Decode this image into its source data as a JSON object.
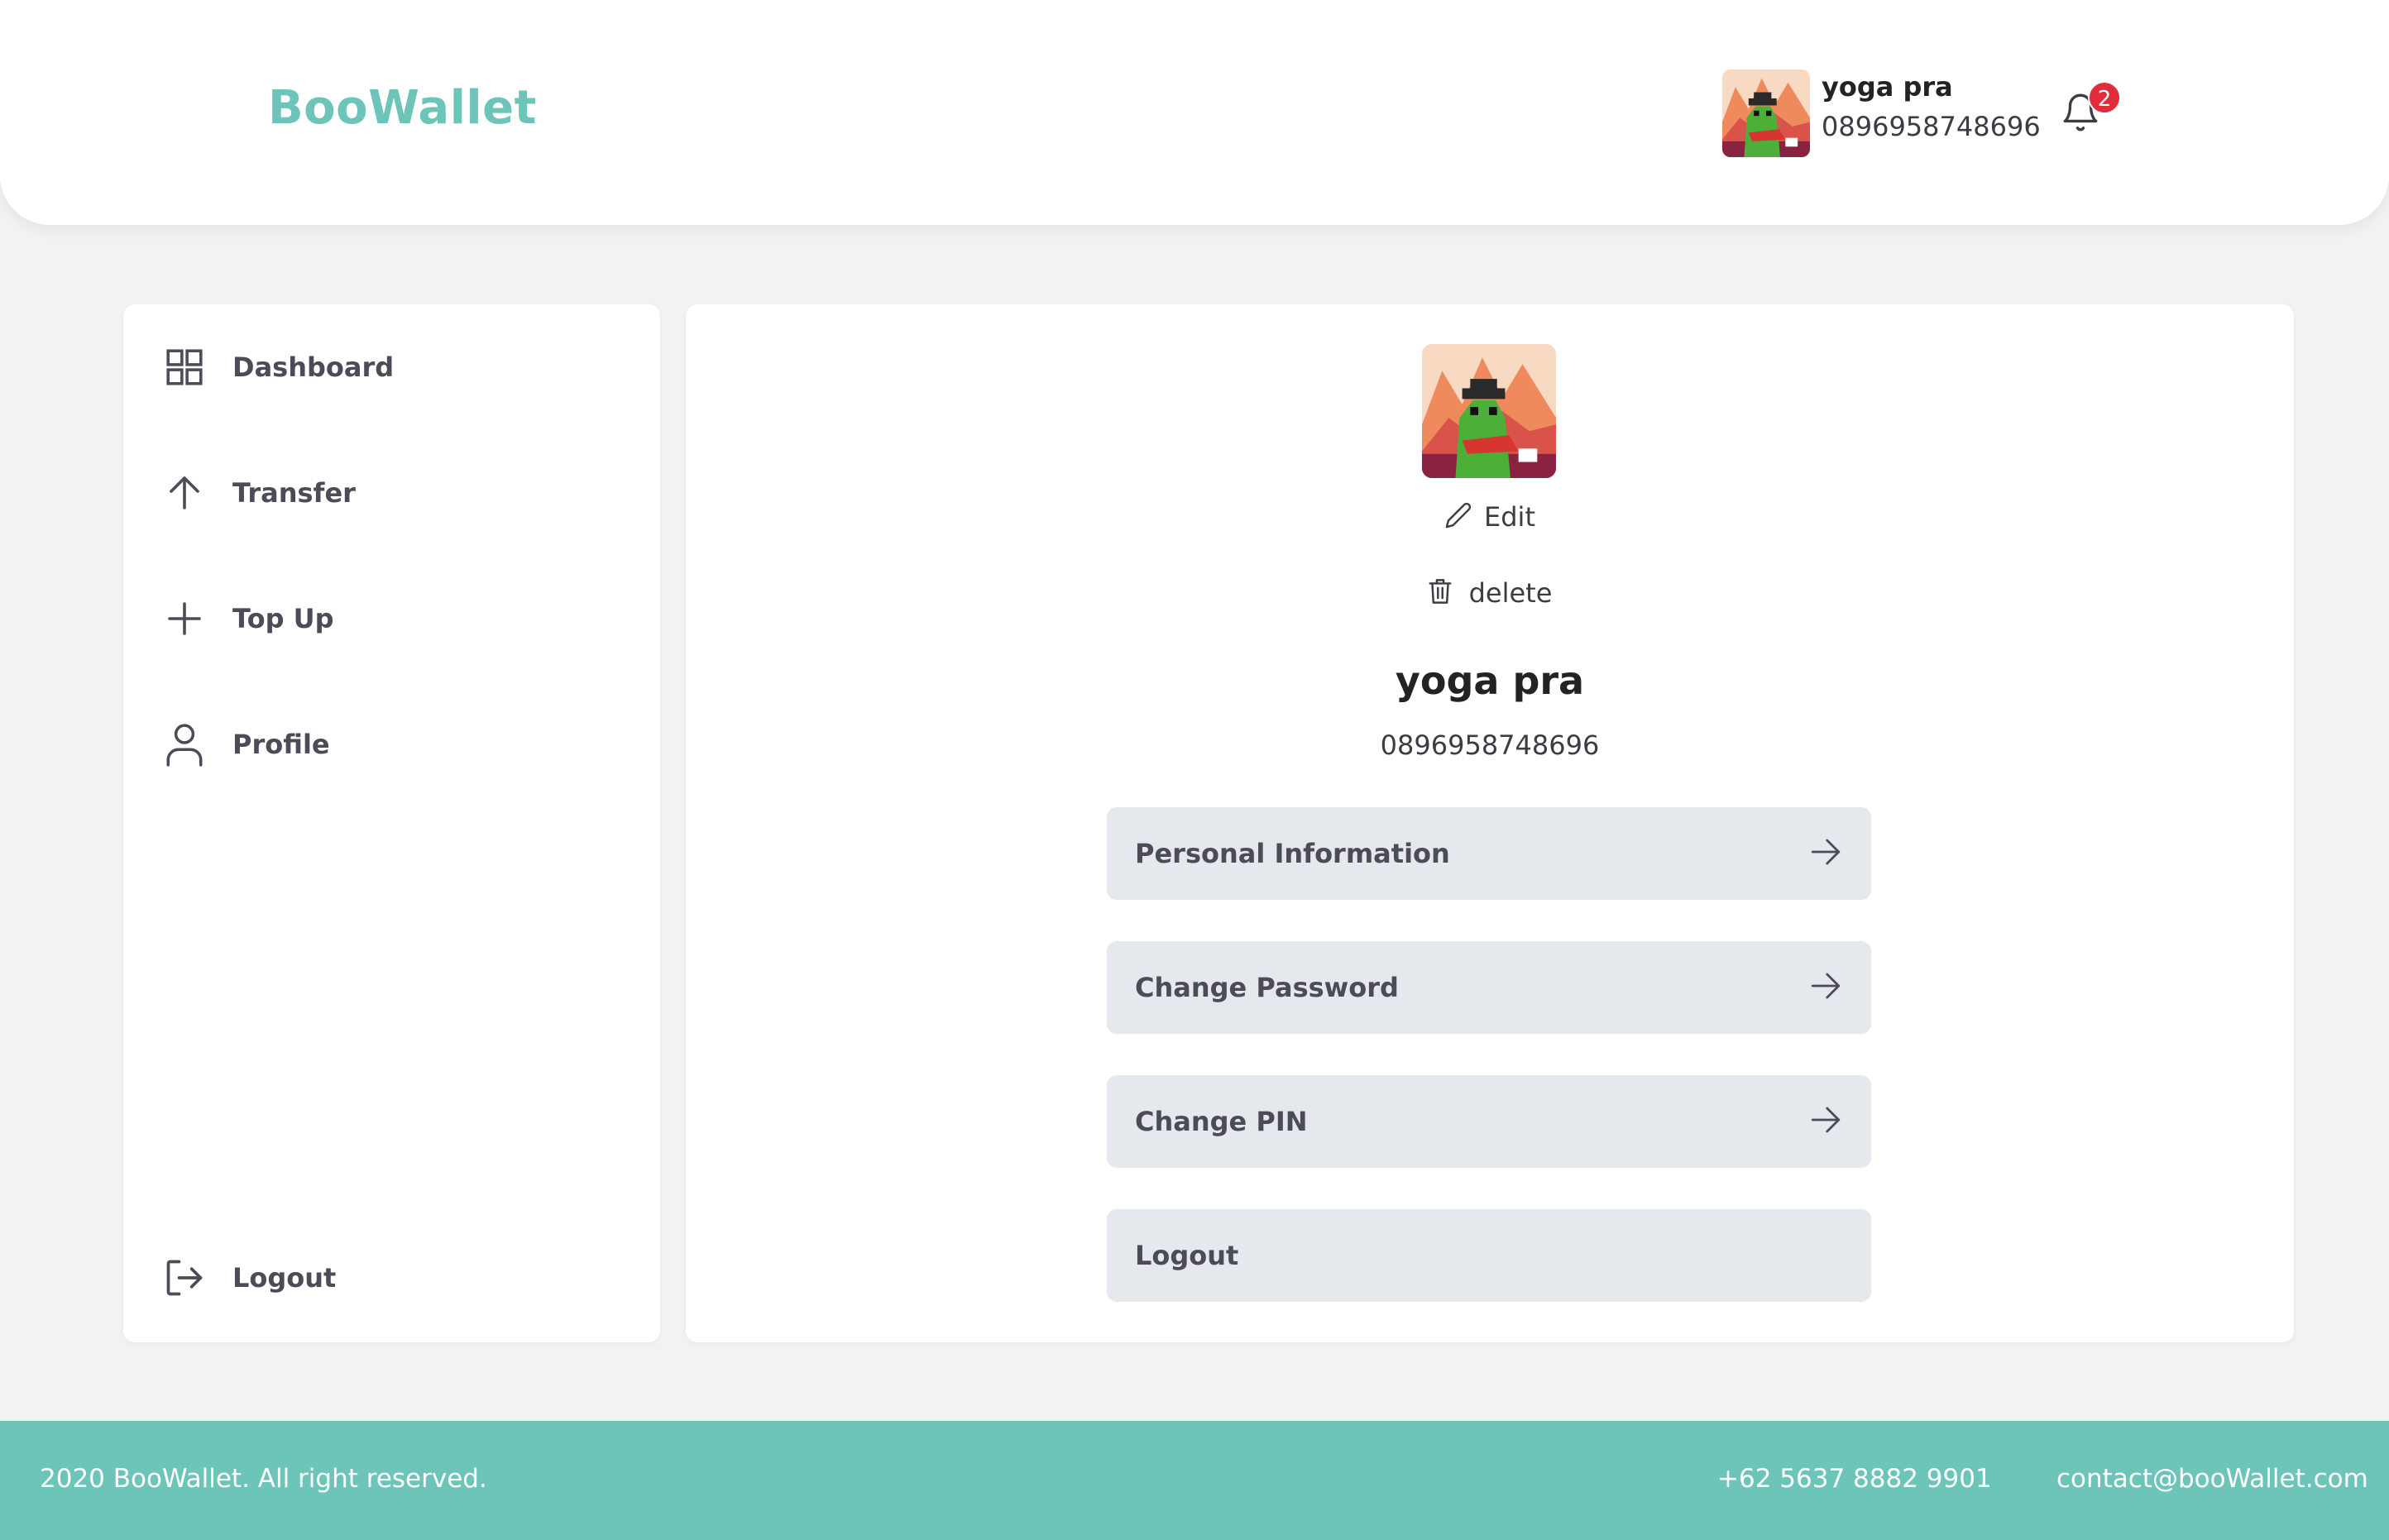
{
  "header": {
    "brand": "BooWallet",
    "user_name": "yoga pra",
    "user_phone": "0896958748696",
    "notification_count": "2"
  },
  "sidebar": {
    "items": [
      {
        "label": "Dashboard",
        "icon": "grid-icon"
      },
      {
        "label": "Transfer",
        "icon": "arrow-up-icon"
      },
      {
        "label": "Top Up",
        "icon": "plus-icon"
      },
      {
        "label": "Profile",
        "icon": "user-icon"
      }
    ],
    "logout_label": "Logout"
  },
  "profile": {
    "edit_label": "Edit",
    "delete_label": "delete",
    "name": "yoga pra",
    "phone": "0896958748696",
    "menu": [
      {
        "label": "Personal Information",
        "arrow": true
      },
      {
        "label": "Change Password",
        "arrow": true
      },
      {
        "label": "Change PIN",
        "arrow": true
      },
      {
        "label": "Logout",
        "arrow": false
      }
    ]
  },
  "footer": {
    "copyright": "2020 BooWallet. All right reserved.",
    "phone": "+62 5637 8882 9901",
    "email": "contact@booWallet.com"
  },
  "colors": {
    "brand": "#6dc4b8",
    "background": "#f0f3f2",
    "menu_button": "#e5e8ed",
    "badge": "#e02d3c"
  }
}
